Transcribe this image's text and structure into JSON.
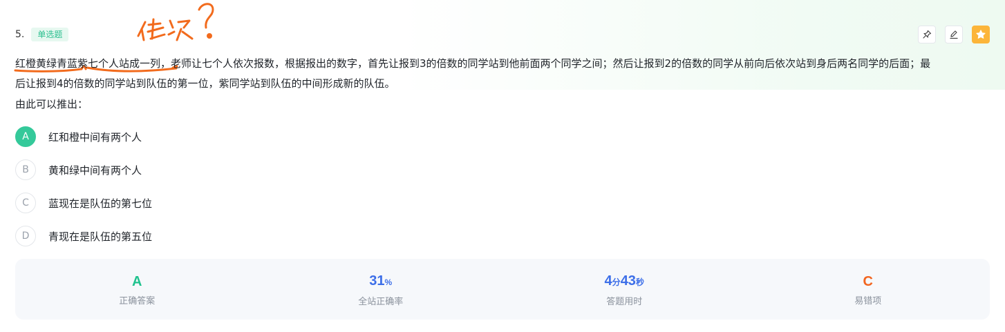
{
  "question": {
    "number": "5.",
    "type_badge": "单选题",
    "stem_line1": "红橙黄绿青蓝紫七个人站成一列，老师让七个人依次报数，根据报出的数字，首先让报到3的倍数的同学站到他前面两个同学之间；然后让报到2的倍数的同学从前向后依次站到身后两名同学的后面；最",
    "stem_line2": "后让报到4的倍数的同学站到队伍的第一位，紫同学站到队伍的中间形成新的队伍。",
    "stem_line3": "由此可以推出："
  },
  "tools": {
    "pin_icon": "pin-icon",
    "edit_icon": "edit-icon",
    "star_icon": "star-icon",
    "star_color": "#fcb53a"
  },
  "options": [
    {
      "letter": "A",
      "text": "红和橙中间有两个人",
      "correct": true
    },
    {
      "letter": "B",
      "text": "黄和绿中间有两个人",
      "correct": false
    },
    {
      "letter": "C",
      "text": "蓝现在是队伍的第七位",
      "correct": false
    },
    {
      "letter": "D",
      "text": "青现在是队伍的第五位",
      "correct": false
    }
  ],
  "stats": {
    "answer": {
      "value": "A",
      "label": "正确答案",
      "color": "#1fc28e"
    },
    "accuracy": {
      "value": "31",
      "unit": "%",
      "label": "全站正确率",
      "color": "#3c6ee8"
    },
    "time": {
      "min": "4",
      "min_unit": "分",
      "sec": "43",
      "sec_unit": "秒",
      "label": "答题用时",
      "color": "#3c6ee8"
    },
    "error_prone": {
      "value": "C",
      "label": "易错项",
      "color": "#f2651f"
    }
  },
  "annotation": {
    "color": "#f26b1d"
  }
}
